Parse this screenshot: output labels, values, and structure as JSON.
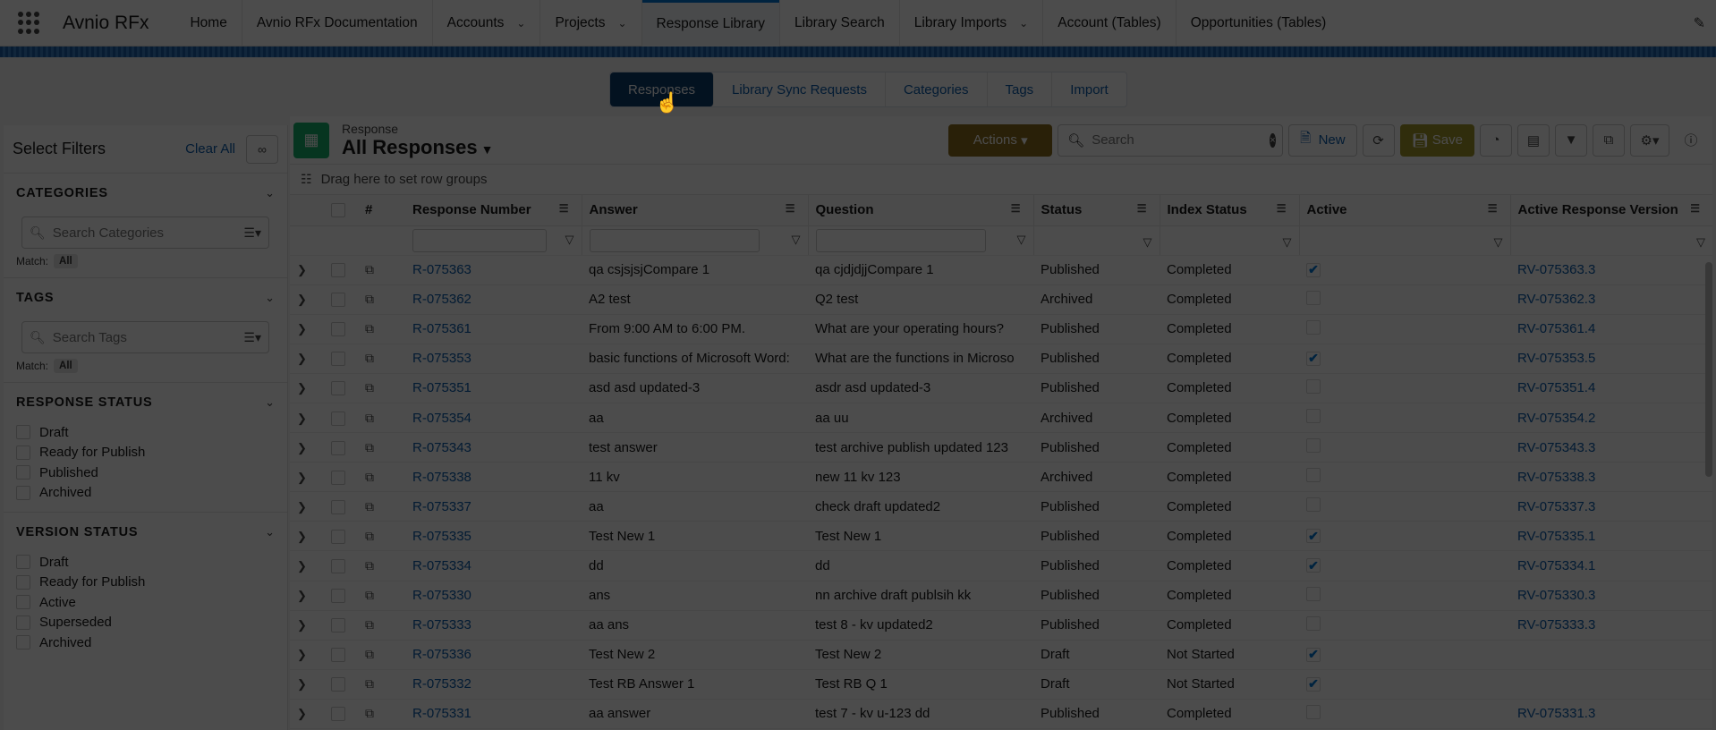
{
  "app": {
    "name": "Avnio RFx"
  },
  "nav": [
    {
      "label": "Home",
      "chevron": false,
      "active": false
    },
    {
      "label": "Avnio RFx Documentation",
      "chevron": false,
      "active": false
    },
    {
      "label": "Accounts",
      "chevron": true,
      "active": false
    },
    {
      "label": "Projects",
      "chevron": true,
      "active": false
    },
    {
      "label": "Response Library",
      "chevron": false,
      "active": true
    },
    {
      "label": "Library Search",
      "chevron": false,
      "active": false
    },
    {
      "label": "Library Imports",
      "chevron": true,
      "active": false
    },
    {
      "label": "Account (Tables)",
      "chevron": false,
      "active": false
    },
    {
      "label": "Opportunities (Tables)",
      "chevron": false,
      "active": false
    }
  ],
  "tabs": [
    {
      "label": "Responses",
      "active": true
    },
    {
      "label": "Library Sync Requests",
      "active": false
    },
    {
      "label": "Categories",
      "active": false
    },
    {
      "label": "Tags",
      "active": false
    },
    {
      "label": "Import",
      "active": false
    }
  ],
  "sidebar": {
    "title": "Select Filters",
    "clear_all": "Clear All",
    "categories": {
      "title": "CATEGORIES",
      "placeholder": "Search Categories",
      "match_label": "Match:",
      "match_value": "All"
    },
    "tags": {
      "title": "TAGS",
      "placeholder": "Search Tags",
      "match_label": "Match:",
      "match_value": "All"
    },
    "response_status": {
      "title": "RESPONSE STATUS",
      "options": [
        "Draft",
        "Ready for Publish",
        "Published",
        "Archived"
      ]
    },
    "version_status": {
      "title": "VERSION STATUS",
      "options": [
        "Draft",
        "Ready for Publish",
        "Active",
        "Superseded",
        "Archived"
      ]
    }
  },
  "list": {
    "object_label": "Response",
    "view_name": "All Responses",
    "actions_label": "Actions",
    "search_placeholder": "Search",
    "new_label": "New",
    "save_label": "Save",
    "group_hint": "Drag here to set row groups"
  },
  "columns": [
    "#",
    "Response Number",
    "Answer",
    "Question",
    "Status",
    "Index Status",
    "Active",
    "Active Response Version"
  ],
  "rows": [
    {
      "num": "R-075363",
      "answer": "qa csjsjsjCompare 1",
      "question": "qa cjdjdjjCompare 1",
      "status": "Published",
      "index": "Completed",
      "active": true,
      "version": "RV-075363.3"
    },
    {
      "num": "R-075362",
      "answer": "A2 test",
      "question": "Q2 test",
      "status": "Archived",
      "index": "Completed",
      "active": false,
      "version": "RV-075362.3"
    },
    {
      "num": "R-075361",
      "answer": "From 9:00 AM to 6:00 PM.",
      "question": "What are your operating hours?",
      "status": "Published",
      "index": "Completed",
      "active": false,
      "version": "RV-075361.4"
    },
    {
      "num": "R-075353",
      "answer": "basic functions of Microsoft Word:",
      "question": "What are the functions in Microso",
      "status": "Published",
      "index": "Completed",
      "active": true,
      "version": "RV-075353.5"
    },
    {
      "num": "R-075351",
      "answer": "asd asd updated-3",
      "question": "asdr asd updated-3",
      "status": "Published",
      "index": "Completed",
      "active": false,
      "version": "RV-075351.4"
    },
    {
      "num": "R-075354",
      "answer": "aa",
      "question": "aa uu",
      "status": "Archived",
      "index": "Completed",
      "active": false,
      "version": "RV-075354.2"
    },
    {
      "num": "R-075343",
      "answer": "test answer",
      "question": "test archive publish updated 123",
      "status": "Published",
      "index": "Completed",
      "active": false,
      "version": "RV-075343.3"
    },
    {
      "num": "R-075338",
      "answer": "11 kv",
      "question": "new 11 kv 123",
      "status": "Archived",
      "index": "Completed",
      "active": false,
      "version": "RV-075338.3"
    },
    {
      "num": "R-075337",
      "answer": "aa",
      "question": "check draft updated2",
      "status": "Published",
      "index": "Completed",
      "active": false,
      "version": "RV-075337.3"
    },
    {
      "num": "R-075335",
      "answer": "Test New 1",
      "question": "Test New 1",
      "status": "Published",
      "index": "Completed",
      "active": true,
      "version": "RV-075335.1"
    },
    {
      "num": "R-075334",
      "answer": "dd",
      "question": "dd",
      "status": "Published",
      "index": "Completed",
      "active": true,
      "version": "RV-075334.1"
    },
    {
      "num": "R-075330",
      "answer": "ans",
      "question": "nn archive draft publsih kk",
      "status": "Published",
      "index": "Completed",
      "active": false,
      "version": "RV-075330.3"
    },
    {
      "num": "R-075333",
      "answer": "aa ans",
      "question": "test 8 - kv updated2",
      "status": "Published",
      "index": "Completed",
      "active": false,
      "version": "RV-075333.3"
    },
    {
      "num": "R-075336",
      "answer": "Test New 2",
      "question": "Test New 2",
      "status": "Draft",
      "index": "Not Started",
      "active": true,
      "version": ""
    },
    {
      "num": "R-075332",
      "answer": "Test RB Answer 1",
      "question": "Test RB Q 1",
      "status": "Draft",
      "index": "Not Started",
      "active": true,
      "version": ""
    },
    {
      "num": "R-075331",
      "answer": "aa answer",
      "question": "test 7 - kv u-123 dd",
      "status": "Published",
      "index": "Completed",
      "active": false,
      "version": "RV-075331.3"
    }
  ]
}
